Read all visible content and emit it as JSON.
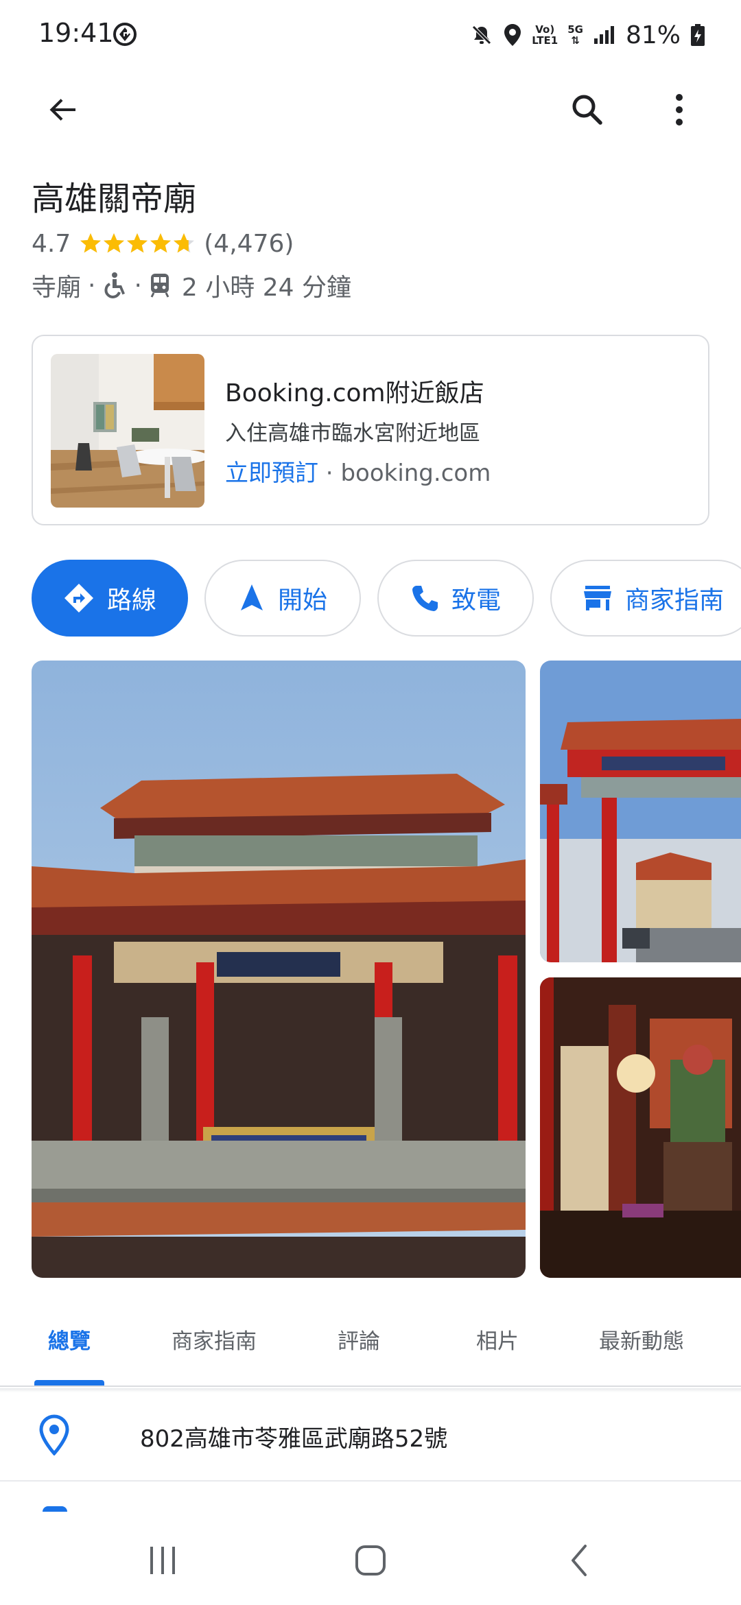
{
  "status_bar": {
    "time": "19:41",
    "network_top": "Vo)",
    "network_bottom": "LTE1",
    "five_g": "5G",
    "battery": "81%"
  },
  "app_bar": {
    "back_icon": "arrow-left-icon",
    "search_icon": "search-icon",
    "more_icon": "more-vertical-icon"
  },
  "place": {
    "name": "高雄關帝廟",
    "rating": "4.7",
    "rating_stars": 4.7,
    "review_count": "(4,476)",
    "category": "寺廟",
    "separator": "·",
    "travel_time": "2 小時 24 分鐘"
  },
  "ad": {
    "title": "Booking.com附近飯店",
    "subtitle": "入住高雄市臨水宮附近地區",
    "cta": "立即預訂",
    "separator": " · ",
    "domain": "booking.com"
  },
  "actions": [
    {
      "label": "路線",
      "icon": "directions-icon"
    },
    {
      "label": "開始",
      "icon": "navigation-icon"
    },
    {
      "label": "致電",
      "icon": "phone-icon"
    },
    {
      "label": "商家指南",
      "icon": "storefront-icon"
    }
  ],
  "tabs": [
    "總覽",
    "商家指南",
    "評論",
    "相片",
    "最新動態"
  ],
  "active_tab": "總覽",
  "address": "802高雄市苓雅區武廟路52號",
  "colors": {
    "accent": "#1a73e8",
    "star": "#fbbc04",
    "text_secondary": "#5f6368"
  }
}
